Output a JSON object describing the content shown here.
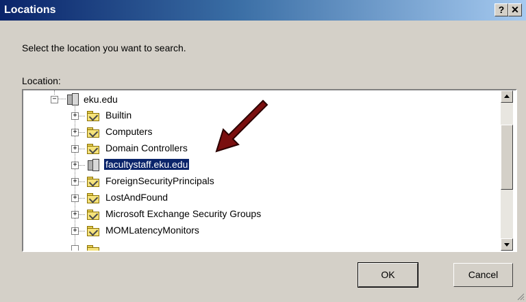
{
  "window": {
    "title": "Locations",
    "help_label": "?",
    "close_label": "✕"
  },
  "dialog": {
    "prompt": "Select the location you want to search.",
    "location_label": "Location:"
  },
  "tree": {
    "root": {
      "label": "eku.edu",
      "icon": "domain-icon",
      "expander": "−"
    },
    "items": [
      {
        "label": "Builtin",
        "icon": "folder-icon",
        "expander": "+"
      },
      {
        "label": "Computers",
        "icon": "folder-icon",
        "expander": "+"
      },
      {
        "label": "Domain Controllers",
        "icon": "folder-icon",
        "expander": "+"
      },
      {
        "label": "facultystaff.eku.edu",
        "icon": "domain-icon",
        "expander": "+",
        "selected": true
      },
      {
        "label": "ForeignSecurityPrincipals",
        "icon": "folder-icon",
        "expander": "+"
      },
      {
        "label": "LostAndFound",
        "icon": "folder-icon",
        "expander": "+"
      },
      {
        "label": "Microsoft Exchange Security Groups",
        "icon": "folder-icon",
        "expander": "+"
      },
      {
        "label": "MOMLatencyMonitors",
        "icon": "folder-icon",
        "expander": "+"
      }
    ]
  },
  "buttons": {
    "ok": "OK",
    "cancel": "Cancel"
  },
  "colors": {
    "selection": "#0a246a",
    "arrow": "#7a0f0f"
  }
}
